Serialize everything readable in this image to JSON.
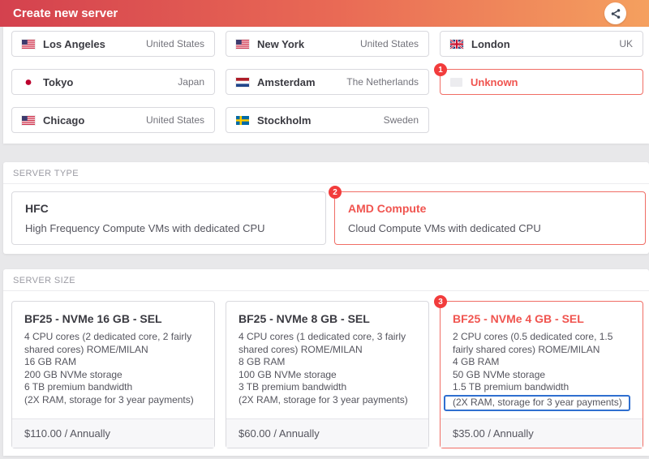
{
  "header": {
    "title": "Create new server"
  },
  "locations": {
    "items": [
      {
        "city": "Los Angeles",
        "country": "United States",
        "flag": "us"
      },
      {
        "city": "New York",
        "country": "United States",
        "flag": "us"
      },
      {
        "city": "London",
        "country": "UK",
        "flag": "uk"
      },
      {
        "city": "Tokyo",
        "country": "Japan",
        "flag": "jp"
      },
      {
        "city": "Amsterdam",
        "country": "The Netherlands",
        "flag": "nl"
      },
      {
        "city": "Unknown",
        "country": "",
        "flag": "unknown",
        "selected": true,
        "badge": "1"
      },
      {
        "city": "Chicago",
        "country": "United States",
        "flag": "us"
      },
      {
        "city": "Stockholm",
        "country": "Sweden",
        "flag": "se"
      }
    ]
  },
  "server_type": {
    "label": "SERVER TYPE",
    "options": [
      {
        "title": "HFC",
        "description": "High Frequency Compute VMs with dedicated CPU"
      },
      {
        "title": "AMD Compute",
        "description": "Cloud Compute VMs with dedicated CPU",
        "selected": true,
        "badge": "2"
      }
    ]
  },
  "server_size": {
    "label": "SERVER SIZE",
    "options": [
      {
        "title": "BF25 - NVMe 16 GB - SEL",
        "specs": [
          "4 CPU cores (2 dedicated core, 2 fairly shared cores) ROME/MILAN",
          "16 GB RAM",
          "200 GB NVMe storage",
          "6 TB premium bandwidth",
          "(2X RAM, storage for 3 year payments)"
        ],
        "price": "$110.00 / Annually"
      },
      {
        "title": "BF25 - NVMe 8 GB - SEL",
        "specs": [
          "4 CPU cores (1 dedicated core, 3 fairly shared cores) ROME/MILAN",
          "8 GB RAM",
          "100 GB NVMe storage",
          "3 TB premium bandwidth",
          "(2X RAM, storage for 3 year payments)"
        ],
        "price": "$60.00 / Annually"
      },
      {
        "title": "BF25 - NVMe 4 GB - SEL",
        "specs": [
          "2 CPU cores (0.5 dedicated core, 1.5 fairly shared cores) ROME/MILAN",
          "4 GB RAM",
          "50 GB NVMe storage",
          "1.5 TB premium bandwidth",
          "(2X RAM, storage for 3 year payments)"
        ],
        "price": "$35.00 / Annually",
        "selected": true,
        "badge": "3",
        "highlighted_spec": "(2X RAM, storage for 3 year payments)"
      }
    ]
  },
  "colors": {
    "header_gradient_start": "#d4414e",
    "header_gradient_end": "#f5a05f",
    "accent_red_text": "#f0544f",
    "accent_red_border": "#f06d65",
    "badge_red": "#f23c3c",
    "highlight_blue": "#2f6fd0",
    "page_background": "#e8e8ea"
  }
}
